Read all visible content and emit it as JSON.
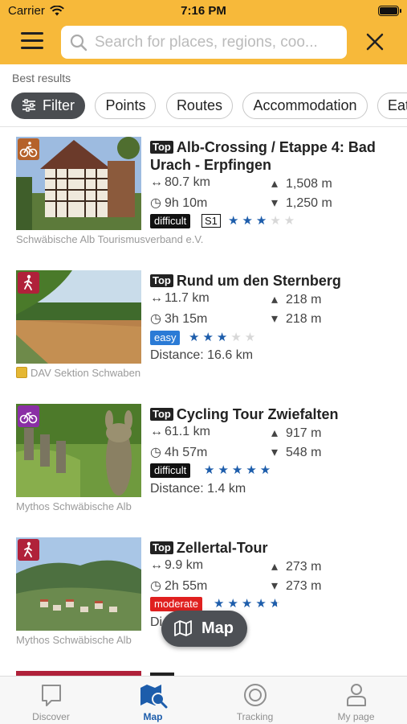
{
  "status_bar": {
    "carrier": "Carrier",
    "time": "7:16 PM"
  },
  "search": {
    "placeholder": "Search for places, regions, coo..."
  },
  "section_label": "Best results",
  "chips": [
    {
      "label": "Filter"
    },
    {
      "label": "Points"
    },
    {
      "label": "Routes"
    },
    {
      "label": "Accommodation"
    },
    {
      "label": "Eat"
    }
  ],
  "results": [
    {
      "top_badge": "Top",
      "title": "Alb-Crossing / Etappe 4: Bad Urach - Erpfingen",
      "category_icon": "bike-icon",
      "category_color": "#b5622b",
      "distance": "80.7 km",
      "duration": "9h 10m",
      "ascent": "1,508 m",
      "descent": "1,250 m",
      "difficulty": "difficult",
      "s_scale": "S1",
      "rating": 3,
      "source": "Schwäbische Alb Tourismusverband e.V."
    },
    {
      "top_badge": "Top",
      "title": "Rund um den Sternberg",
      "category_icon": "hiking-icon",
      "category_color": "#b0213a",
      "distance": "11.7 km",
      "duration": "3h 15m",
      "ascent": "218 m",
      "descent": "218 m",
      "difficulty": "easy",
      "rating": 3,
      "distance_from": "Distance: 16.6 km",
      "source": "DAV Sektion Schwaben"
    },
    {
      "top_badge": "Top",
      "title": "Cycling Tour Zwiefalten",
      "category_icon": "bike-icon",
      "category_color": "#8a2fa5",
      "distance": "61.1 km",
      "duration": "4h 57m",
      "ascent": "917 m",
      "descent": "548 m",
      "difficulty": "difficult",
      "rating": 5,
      "distance_from": "Distance: 1.4 km",
      "source": "Mythos Schwäbische Alb"
    },
    {
      "top_badge": "Top",
      "title": "Zellertal-Tour",
      "category_icon": "hiking-icon",
      "category_color": "#b0213a",
      "distance": "9.9 km",
      "duration": "2h 55m",
      "ascent": "273 m",
      "descent": "273 m",
      "difficulty": "moderate",
      "rating": 4.5,
      "distance_from": "Di",
      "source": "Mythos Schwäbische Alb"
    }
  ],
  "map_button": {
    "label": "Map",
    "icon": "map-icon"
  },
  "tabbar": [
    {
      "label": "Discover",
      "icon": "discover-icon",
      "active": false
    },
    {
      "label": "Map",
      "icon": "map-search-icon",
      "active": true
    },
    {
      "label": "Tracking",
      "icon": "tracking-icon",
      "active": false
    },
    {
      "label": "My page",
      "icon": "person-icon",
      "active": false
    }
  ],
  "colors": {
    "header": "#f7b93a",
    "accent": "#1d5dab",
    "difficult": "#111111",
    "easy": "#2b7bd6",
    "moderate": "#e0201f"
  }
}
